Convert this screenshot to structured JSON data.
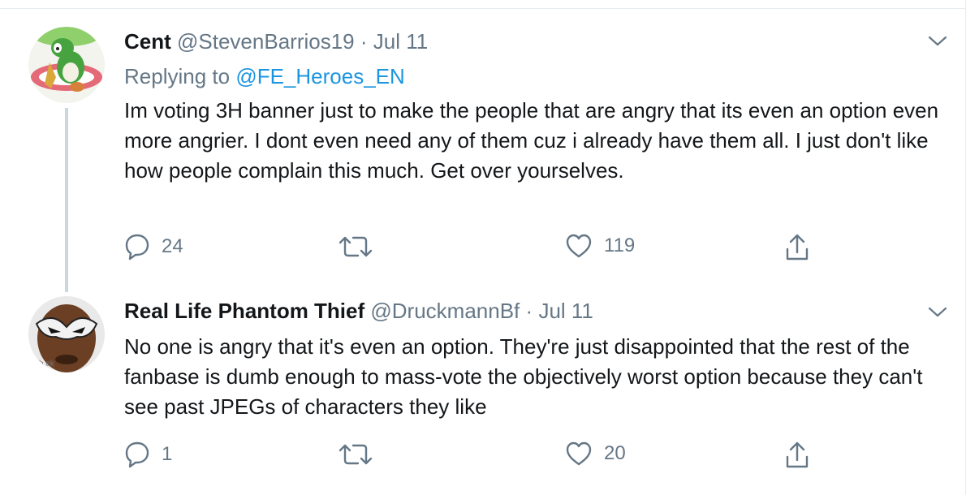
{
  "tweets": [
    {
      "display_name": "Cent",
      "handle": "@StevenBarrios19",
      "separator": "·",
      "date": "Jul 11",
      "replying_prefix": "Replying to",
      "replying_to": "@FE_Heroes_EN",
      "text": "Im voting 3H banner just to make the people that are angry that its even an option even more angrier. I dont even need any of them cuz i already have them all. I just don't like how people complain this much. Get over yourselves.",
      "replies": "24",
      "retweets": "",
      "likes": "119",
      "avatar_icon": "yoshi-avatar-icon"
    },
    {
      "display_name": "Real Life Phantom Thief",
      "handle": "@DruckmannBf",
      "separator": "·",
      "date": "Jul 11",
      "avatar_watermark": "sh   ek",
      "text": "No one is angry that it's even an option. They're just disappointed that the rest of the fanbase is dumb enough to mass-vote the objectively worst option because they can't see past JPEGs of characters they like",
      "replies": "1",
      "retweets": "",
      "likes": "20",
      "avatar_icon": "masked-face-avatar-icon"
    }
  ],
  "icons": {
    "reply": "reply-icon",
    "retweet": "retweet-icon",
    "like": "heart-icon",
    "share": "share-icon",
    "more": "chevron-down-icon"
  },
  "colors": {
    "text": "#14171a",
    "secondary": "#657786",
    "link": "#1b95e0",
    "divider": "#e6ecf0",
    "thread_line": "#ccd6dd"
  }
}
